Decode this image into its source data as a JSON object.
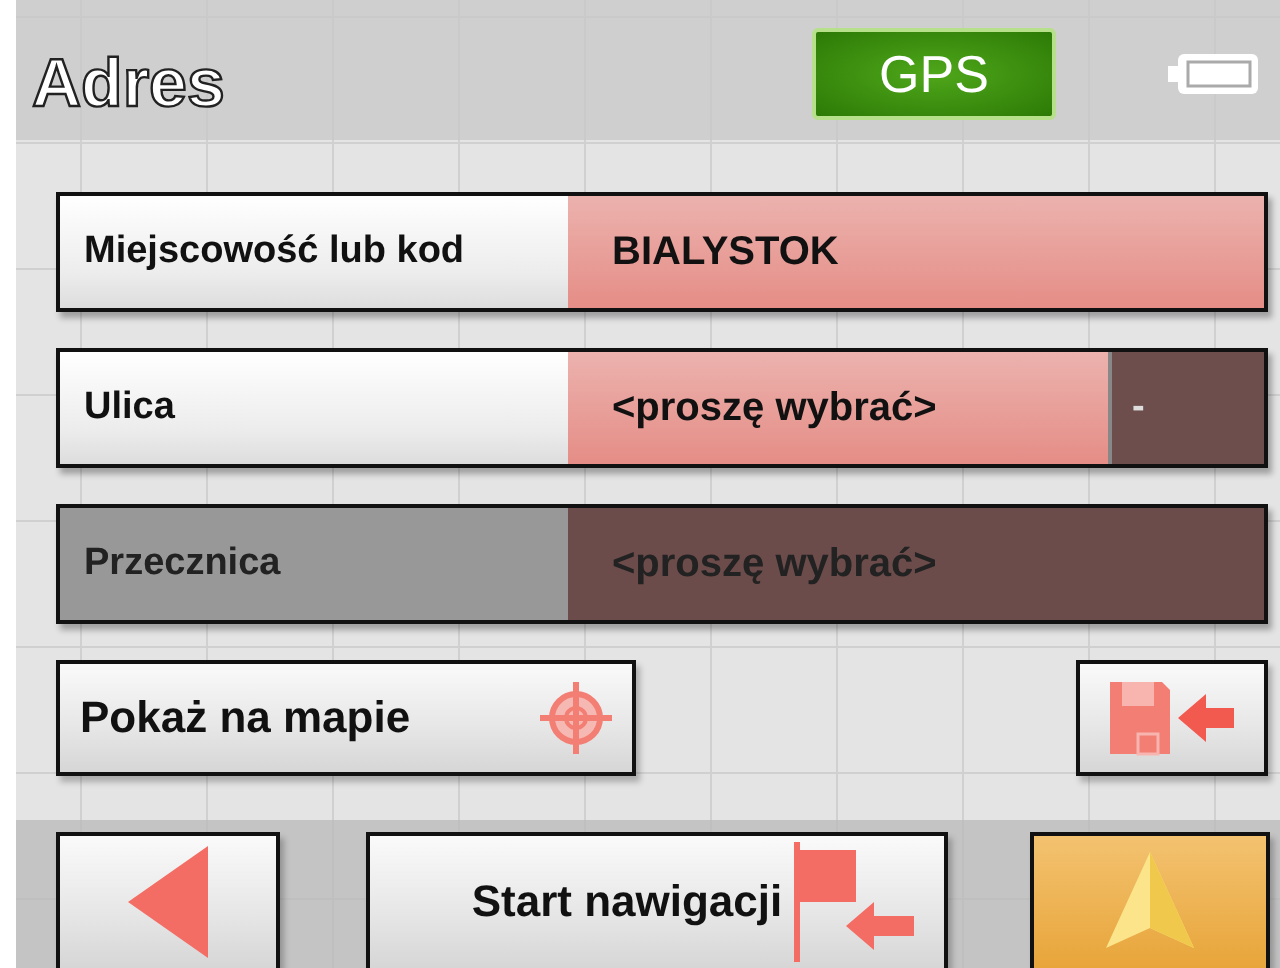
{
  "title": "Adres",
  "gps": {
    "label": "GPS"
  },
  "fields": [
    {
      "label": "Miejscowość lub kod",
      "value": "BIALYSTOK",
      "disabled": false
    },
    {
      "label": "Ulica",
      "value": "<proszę wybrać>",
      "disabled": false,
      "extra": "-"
    },
    {
      "label": "Przecznica",
      "value": "<proszę wybrać>",
      "disabled": true
    }
  ],
  "show_on_map": "Pokaż na mapie",
  "start": "Start nawigacji"
}
